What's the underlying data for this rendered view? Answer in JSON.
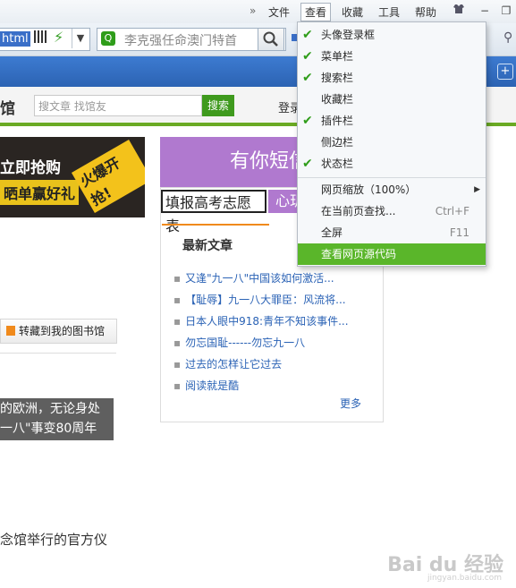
{
  "menubar": {
    "chevron": "»",
    "items": [
      "文件",
      "查看",
      "收藏",
      "工具",
      "帮助"
    ],
    "active_index": 1
  },
  "addressbar": {
    "url_visible": "html",
    "search_placeholder": "李克强任命澳门特首"
  },
  "site": {
    "logo_fragment": "馆",
    "search_placeholder": "搜文章 找馆友",
    "search_button": "搜索",
    "login": "登录",
    "banner_line1": "立即抢购",
    "banner_line2": "晒单赢好礼",
    "banner_badge": "火爆开抢!",
    "purple_text": "有你短信",
    "tab_input_text": "填报高考志愿表",
    "tab_heart_text": "心玑",
    "news_heading": "最新文章",
    "news": [
      "又逢\"九一八\"中国该如何激活...",
      "【耻辱】九一八大罪臣：风流将...",
      "日本人眼中918:青年不知该事件...",
      "勿忘国耻------勿忘九一八",
      "过去的怎样让它过去",
      "阅读就是酷"
    ],
    "more": "更多",
    "collect_button": "转藏到我的图书馆",
    "dark_line1": "的欧洲，无论身处",
    "dark_line2": "一八\"事变80周年",
    "bottom_text": "念馆举行的官方仪"
  },
  "dropdown": {
    "items": [
      {
        "label": "头像登录框",
        "checked": true,
        "shortcut": "",
        "submenu": false
      },
      {
        "label": "菜单栏",
        "checked": true,
        "shortcut": "",
        "submenu": false
      },
      {
        "label": "搜索栏",
        "checked": true,
        "shortcut": "",
        "submenu": false
      },
      {
        "label": "收藏栏",
        "checked": false,
        "shortcut": "",
        "submenu": false
      },
      {
        "label": "插件栏",
        "checked": true,
        "shortcut": "",
        "submenu": false
      },
      {
        "label": "侧边栏",
        "checked": false,
        "shortcut": "",
        "submenu": false
      },
      {
        "label": "状态栏",
        "checked": true,
        "shortcut": "",
        "submenu": false
      },
      {
        "label": "网页缩放（100%）",
        "checked": false,
        "shortcut": "",
        "submenu": true
      },
      {
        "label": "在当前页查找...",
        "checked": false,
        "shortcut": "Ctrl+F",
        "submenu": false
      },
      {
        "label": "全屏",
        "checked": false,
        "shortcut": "F11",
        "submenu": false
      },
      {
        "label": "查看网页源代码",
        "checked": false,
        "shortcut": "",
        "submenu": false,
        "highlighted": true
      }
    ]
  },
  "watermark": {
    "main": "Bai du 经验",
    "sub": "jingyan.baidu.com"
  },
  "colors": {
    "accent_green": "#5ab62a",
    "check_green": "#2f9d1a",
    "purple": "#b079cf",
    "browser_blue": "#3d7bd1"
  }
}
